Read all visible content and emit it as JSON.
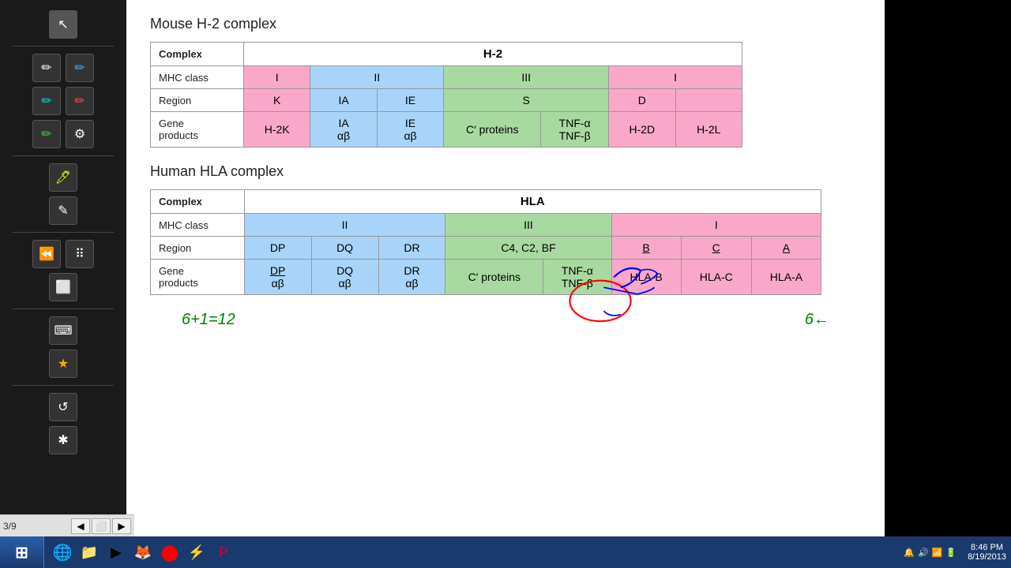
{
  "toolbar": {
    "tools": [
      {
        "name": "arrow",
        "symbol": "↖"
      },
      {
        "name": "pen",
        "symbol": "✏"
      },
      {
        "name": "blue-pen",
        "symbol": "✏"
      },
      {
        "name": "cyan-pen",
        "symbol": "✏"
      },
      {
        "name": "red-pen",
        "symbol": "✏"
      },
      {
        "name": "green-pen",
        "symbol": "✏"
      },
      {
        "name": "settings",
        "symbol": "⚙"
      },
      {
        "name": "marker",
        "symbol": "✏"
      },
      {
        "name": "pencil",
        "symbol": "✎"
      },
      {
        "name": "rewind",
        "symbol": "⏪"
      },
      {
        "name": "grid",
        "symbol": "⋮⋮"
      },
      {
        "name": "eraser",
        "symbol": "⬜"
      },
      {
        "name": "keyboard",
        "symbol": "⌨"
      },
      {
        "name": "star",
        "symbol": "★"
      },
      {
        "name": "undo",
        "symbol": "↺"
      },
      {
        "name": "options",
        "symbol": "✱"
      }
    ]
  },
  "mouse_table": {
    "title": "Mouse H-2 complex",
    "header_label": "Complex",
    "header_value": "H-2",
    "rows": [
      {
        "label": "MHC class",
        "cells": [
          {
            "text": "I",
            "color": "pink"
          },
          {
            "text": "II",
            "color": "blue",
            "colspan": 2
          },
          {
            "text": "III",
            "color": "green"
          },
          {
            "text": "I",
            "color": "pink"
          }
        ]
      },
      {
        "label": "Region",
        "cells": [
          {
            "text": "K",
            "color": "pink"
          },
          {
            "text": "IA",
            "color": "blue"
          },
          {
            "text": "IE",
            "color": "blue"
          },
          {
            "text": "S",
            "color": "green"
          },
          {
            "text": "D",
            "color": "pink"
          }
        ]
      },
      {
        "label": "Gene products",
        "cells": [
          {
            "text": "H-2K",
            "color": "pink"
          },
          {
            "text": "IA αβ",
            "color": "blue"
          },
          {
            "text": "IE αβ",
            "color": "blue"
          },
          {
            "text": "C′ proteins",
            "color": "green"
          },
          {
            "text": "TNF-α TNF-β",
            "color": "green"
          },
          {
            "text": "H-2D",
            "color": "pink"
          },
          {
            "text": "H-2L",
            "color": "pink"
          }
        ]
      }
    ]
  },
  "human_table": {
    "title": "Human HLA complex",
    "header_label": "Complex",
    "header_value": "HLA",
    "rows": [
      {
        "label": "MHC class",
        "cells": [
          {
            "text": "II",
            "color": "blue"
          },
          {
            "text": "III",
            "color": "green"
          },
          {
            "text": "I",
            "color": "pink"
          }
        ]
      },
      {
        "label": "Region",
        "cells": [
          {
            "text": "DP",
            "color": "blue"
          },
          {
            "text": "DQ",
            "color": "blue"
          },
          {
            "text": "DR",
            "color": "blue"
          },
          {
            "text": "C4, C2, BF",
            "color": "green"
          },
          {
            "text": "B",
            "color": "pink",
            "underline": true
          },
          {
            "text": "C",
            "color": "pink",
            "underline": true
          },
          {
            "text": "A",
            "color": "pink",
            "underline": true
          }
        ]
      },
      {
        "label": "Gene products",
        "cells": [
          {
            "text": "DP αβ",
            "color": "blue",
            "underline_part": "DP"
          },
          {
            "text": "DQ αβ",
            "color": "blue"
          },
          {
            "text": "DR αβ",
            "color": "blue"
          },
          {
            "text": "C′ proteins",
            "color": "green"
          },
          {
            "text": "TNF-α TNF-β",
            "color": "green"
          },
          {
            "text": "HLA-B",
            "color": "pink"
          },
          {
            "text": "HLA-C",
            "color": "pink"
          },
          {
            "text": "HLA-A",
            "color": "pink"
          }
        ]
      }
    ]
  },
  "status": {
    "page": "3/9"
  },
  "clock": {
    "time": "8:46 PM",
    "date": "8/19/2013"
  },
  "green_annotation_left": "6+1=12",
  "green_annotation_right": "6←"
}
